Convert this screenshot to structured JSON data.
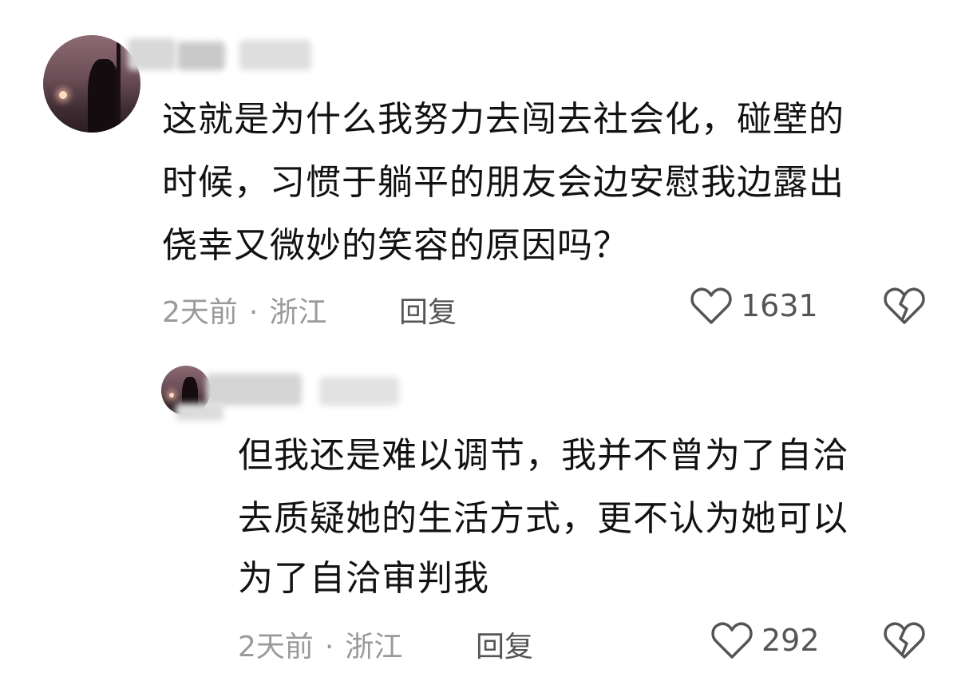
{
  "comments": [
    {
      "text_lines": [
        "这就是为什么我努力去闯去社会化，碰壁的",
        "时候，习惯于躺平的朋友会边安慰我边露出",
        "侥幸又微妙的笑容的原因吗？"
      ],
      "time": "2天前",
      "location": "浙江",
      "reply_label": "回复",
      "like_count": "1631",
      "icons": {
        "like": "heart-outline-icon",
        "dislike": "broken-heart-icon"
      }
    },
    {
      "text_lines": [
        "但我还是难以调节，我并不曾为了自洽",
        "去质疑她的生活方式，更不认为她可以",
        "为了自洽审判我"
      ],
      "time": "2天前",
      "location": "浙江",
      "reply_label": "回复",
      "like_count": "292",
      "icons": {
        "like": "heart-outline-icon",
        "dislike": "broken-heart-icon"
      }
    }
  ],
  "separator": "·",
  "colors": {
    "text": "#121212",
    "meta": "#9a9a9a",
    "action": "#555555",
    "background": "#ffffff"
  }
}
